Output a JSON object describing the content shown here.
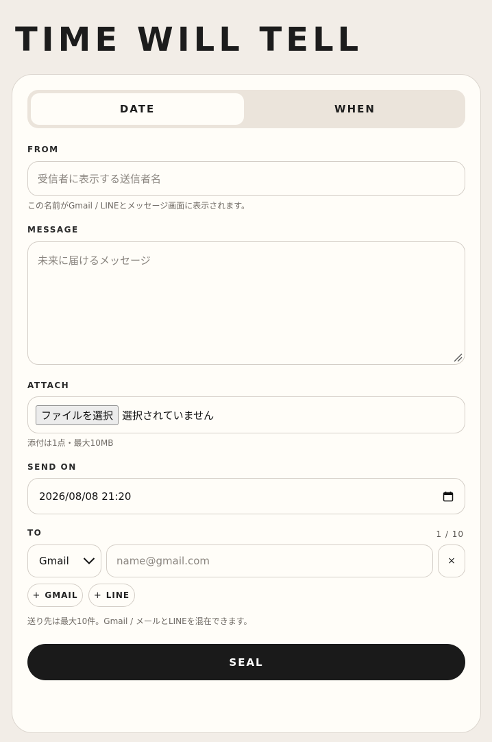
{
  "app": {
    "title": "TIME WILL TELL"
  },
  "tabs": [
    {
      "label": "DATE",
      "active": true
    },
    {
      "label": "WHEN",
      "active": false
    }
  ],
  "from": {
    "label": "FROM",
    "placeholder": "受信者に表示する送信者名",
    "value": "",
    "hint": "この名前がGmail / LINEとメッセージ画面に表示されます。"
  },
  "message": {
    "label": "MESSAGE",
    "placeholder": "未来に届けるメッセージ",
    "value": ""
  },
  "attach": {
    "label": "ATTACH",
    "button_label": "ファイルを選択",
    "status": "選択されていません",
    "hint": "添付は1点・最大10MB"
  },
  "send_on": {
    "label": "SEND ON",
    "value": "2026/08/08 21:20"
  },
  "to": {
    "label": "TO",
    "count": "1 / 10",
    "channel_selected": "Gmail",
    "address_placeholder": "name@gmail.com",
    "address_value": "",
    "remove_label": "×",
    "add_gmail_label": "GMAIL",
    "add_line_label": "LINE",
    "plus_glyph": "+",
    "hint": "送り先は最大10件。Gmail / メールとLINEを混在できます。"
  },
  "seal": {
    "label": "SEAL"
  },
  "colors": {
    "page_bg": "#f2ede7",
    "card_bg": "#fffdf8",
    "tab_track": "#ebe4db",
    "primary": "#1a1a1a"
  }
}
